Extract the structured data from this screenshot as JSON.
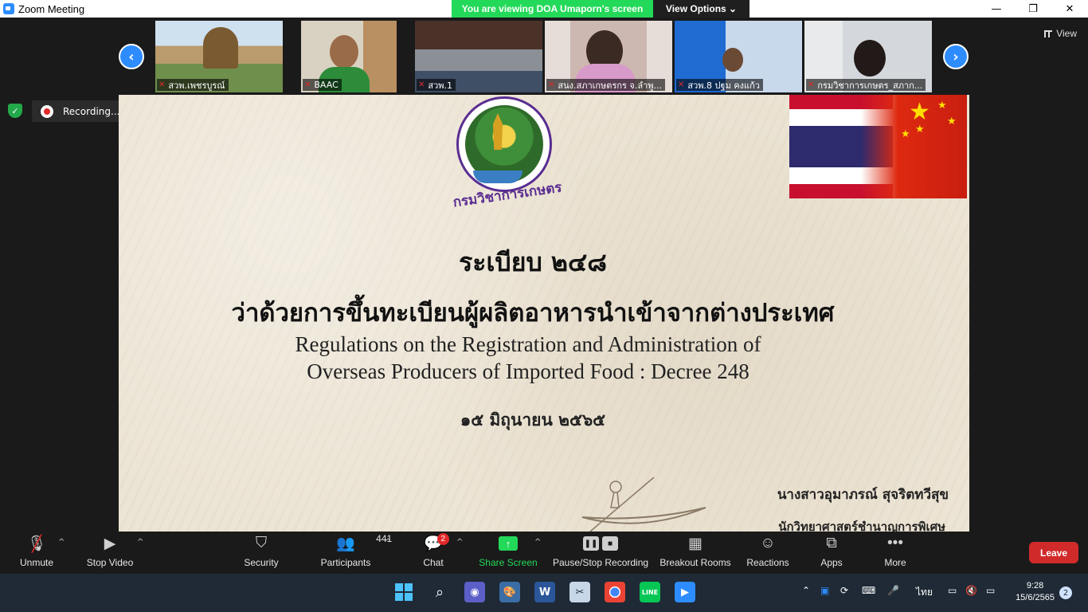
{
  "window": {
    "title": "Zoom Meeting",
    "minimize": "—",
    "restore": "❐",
    "close": "✕"
  },
  "banner": {
    "message": "You are viewing DOA Umaporn's screen",
    "view_options": "View Options ⌄"
  },
  "strip": {
    "prev": "‹",
    "next": "›",
    "view_label": "View",
    "participants": [
      {
        "name": "สวพ.เพชรบูรณ์",
        "bg": "#8aa6b8"
      },
      {
        "name": "BAAC",
        "bg": "#9a8a70"
      },
      {
        "name": "สวพ.1",
        "bg": "#5d6f86"
      },
      {
        "name": "สนง.สภาเกษตรกร จ.ลำพู...",
        "bg": "#b9a7a0"
      },
      {
        "name": "สวพ.8 ปฐม คงแก้ว",
        "bg": "#6e8fb6"
      },
      {
        "name": "กรมวิชาการเกษตร_สภาก...",
        "bg": "#d3d6d8"
      }
    ]
  },
  "recording": {
    "label": "Recording...",
    "pause": "❚❚",
    "stop": "■"
  },
  "slide": {
    "seal_text": "กรมวิชาการเกษตร",
    "title_th": "ระเบียบ ๒๔๘",
    "subtitle_th": "ว่าด้วยการขึ้นทะเบียนผู้ผลิตอาหารนำเข้าจากต่างประเทศ",
    "title_en_1": "Regulations on the Registration and Administration of",
    "title_en_2": "Overseas Producers of Imported Food :  Decree 248",
    "date": "๑๕ มิถุนายน ๒๕๖๕",
    "presenter": "นางสาวอุมาภรณ์   สุจริตทวีสุข",
    "position": "นักวิทยาศาสตร์ชำนาญการพิเศษ"
  },
  "toolbar": {
    "unmute": "Unmute",
    "stop_video": "Stop Video",
    "security": "Security",
    "participants": "Participants",
    "participants_count": "441",
    "chat": "Chat",
    "chat_badge": "2",
    "share_screen": "Share Screen",
    "pause_stop_recording": "Pause/Stop Recording",
    "breakout_rooms": "Breakout Rooms",
    "reactions": "Reactions",
    "apps": "Apps",
    "more": "More",
    "leave": "Leave",
    "caret": "^"
  },
  "taskbar": {
    "lang": "ไทย",
    "time": "9:28",
    "date": "15/6/2565",
    "notifications": "2"
  },
  "colors": {
    "accent": "#2d8cff",
    "green": "#23d959",
    "leave": "#d12a2a"
  }
}
